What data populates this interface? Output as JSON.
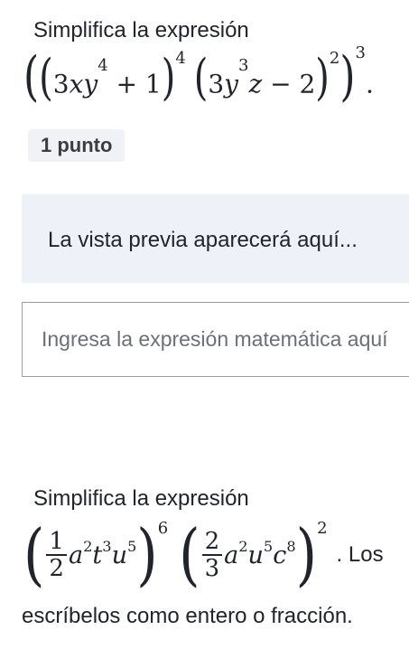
{
  "q1": {
    "prompt": "Simplifica la expresión",
    "expression_label": "((3xy^4 + 1)^4 (3y^3z − 2)^2)^3.",
    "badge": "1 punto",
    "preview_text": "La vista previa aparecerá aquí...",
    "answer_placeholder": "Ingresa la expresión matemática aquí"
  },
  "q2": {
    "prompt": "Simplifica la expresión",
    "expression_label": "((1/2)a^2t^3u^5)^6 ((2/3)a^2u^5c^8)^2",
    "suffix": ". Los",
    "continuation": "escríbelos como entero o fracción."
  }
}
